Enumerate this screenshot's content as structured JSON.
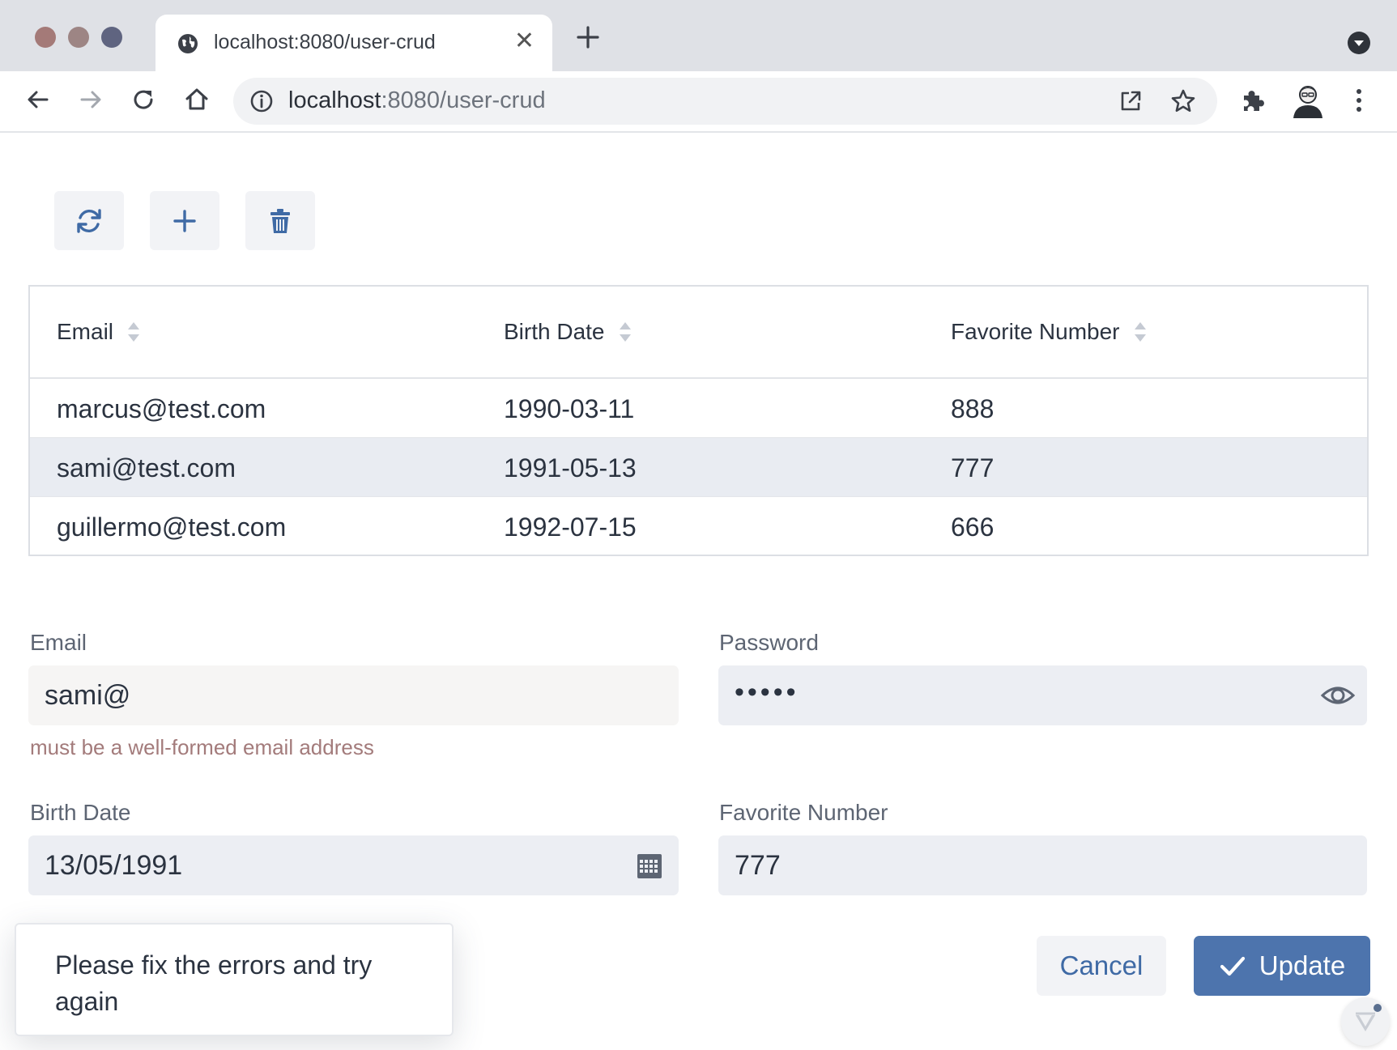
{
  "browser": {
    "tab_title": "localhost:8080/user-crud",
    "url_host": "localhost",
    "url_rest": ":8080/user-crud"
  },
  "grid": {
    "columns": [
      "Email",
      "Birth Date",
      "Favorite Number"
    ],
    "rows": [
      {
        "email": "marcus@test.com",
        "birth_date": "1990-03-11",
        "favorite_number": "888",
        "selected": false
      },
      {
        "email": "sami@test.com",
        "birth_date": "1991-05-13",
        "favorite_number": "777",
        "selected": true
      },
      {
        "email": "guillermo@test.com",
        "birth_date": "1992-07-15",
        "favorite_number": "666",
        "selected": false
      }
    ]
  },
  "form": {
    "email_label": "Email",
    "email_value": "sami@",
    "email_error": "must be a well-formed email address",
    "password_label": "Password",
    "password_value": "•••••",
    "birth_date_label": "Birth Date",
    "birth_date_value": "13/05/1991",
    "favorite_number_label": "Favorite Number",
    "favorite_number_value": "777",
    "cancel_label": "Cancel",
    "update_label": "Update"
  },
  "notification": {
    "text": "Please fix the errors and try again"
  },
  "colors": {
    "primary": "#4d74ad",
    "error": "#a37b7b",
    "selected_row": "#e9ecf2"
  },
  "icons": {
    "refresh": "refresh-icon",
    "add": "plus-icon",
    "delete": "trash-icon",
    "calendar": "calendar-icon",
    "reveal": "eye-icon"
  }
}
